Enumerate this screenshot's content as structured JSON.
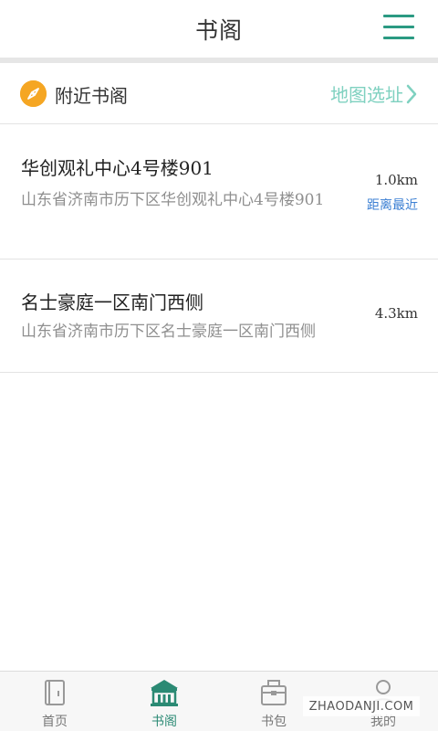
{
  "header": {
    "title": "书阁",
    "menu_icon": "menu-icon"
  },
  "nearby": {
    "label": "附近书阁",
    "map_pick_label": "地图选址",
    "icon": "compass-icon"
  },
  "libraries": [
    {
      "name": "华创观礼中心4号楼901",
      "address": "山东省济南市历下区华创观礼中心4号楼901",
      "distance": "1.0km",
      "tag": "距离最近"
    },
    {
      "name": "名士豪庭一区南门西侧",
      "address": "山东省济南市历下区名士豪庭一区南门西侧",
      "distance": "4.3km"
    }
  ],
  "tabs": [
    {
      "label": "首页",
      "icon": "home-book-icon",
      "active": false
    },
    {
      "label": "书阁",
      "icon": "library-icon",
      "active": true
    },
    {
      "label": "书包",
      "icon": "bag-icon",
      "active": false
    },
    {
      "label": "我的",
      "icon": "user-icon",
      "active": false
    }
  ],
  "watermark": "ZHAODANJI.COM",
  "colors": {
    "accent": "#2b9a82",
    "map_pick": "#7fd1c0",
    "nearest_tag": "#3b7fd3",
    "compass": "#f5a623"
  }
}
